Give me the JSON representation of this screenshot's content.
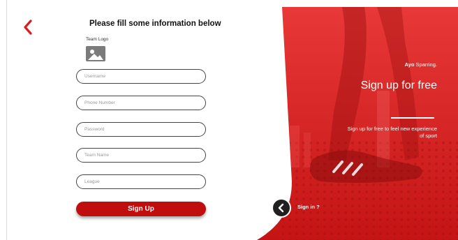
{
  "nav": {
    "back_icon": "chevron-left-icon",
    "accent_color": "#d81e1e"
  },
  "form": {
    "title": "Please fill some  information below",
    "logo_label": "Team Logo",
    "logo_icon": "image-placeholder-icon",
    "fields": [
      {
        "placeholder": "Username"
      },
      {
        "placeholder": "Phone Number"
      },
      {
        "placeholder": "Password"
      },
      {
        "placeholder": "Team Name"
      },
      {
        "placeholder": "League"
      }
    ],
    "submit_label": "Sign Up",
    "submit_color": "#c00d0d"
  },
  "hero": {
    "brand_bold": "Ayo",
    "brand_rest": " Sparring.",
    "heading": "Sign up for free",
    "subheading": "Sign up for free to feel new experience of sport",
    "overlay_color": "#e02020"
  },
  "signin": {
    "label": "Sign in ?",
    "icon": "chevron-left-icon"
  }
}
